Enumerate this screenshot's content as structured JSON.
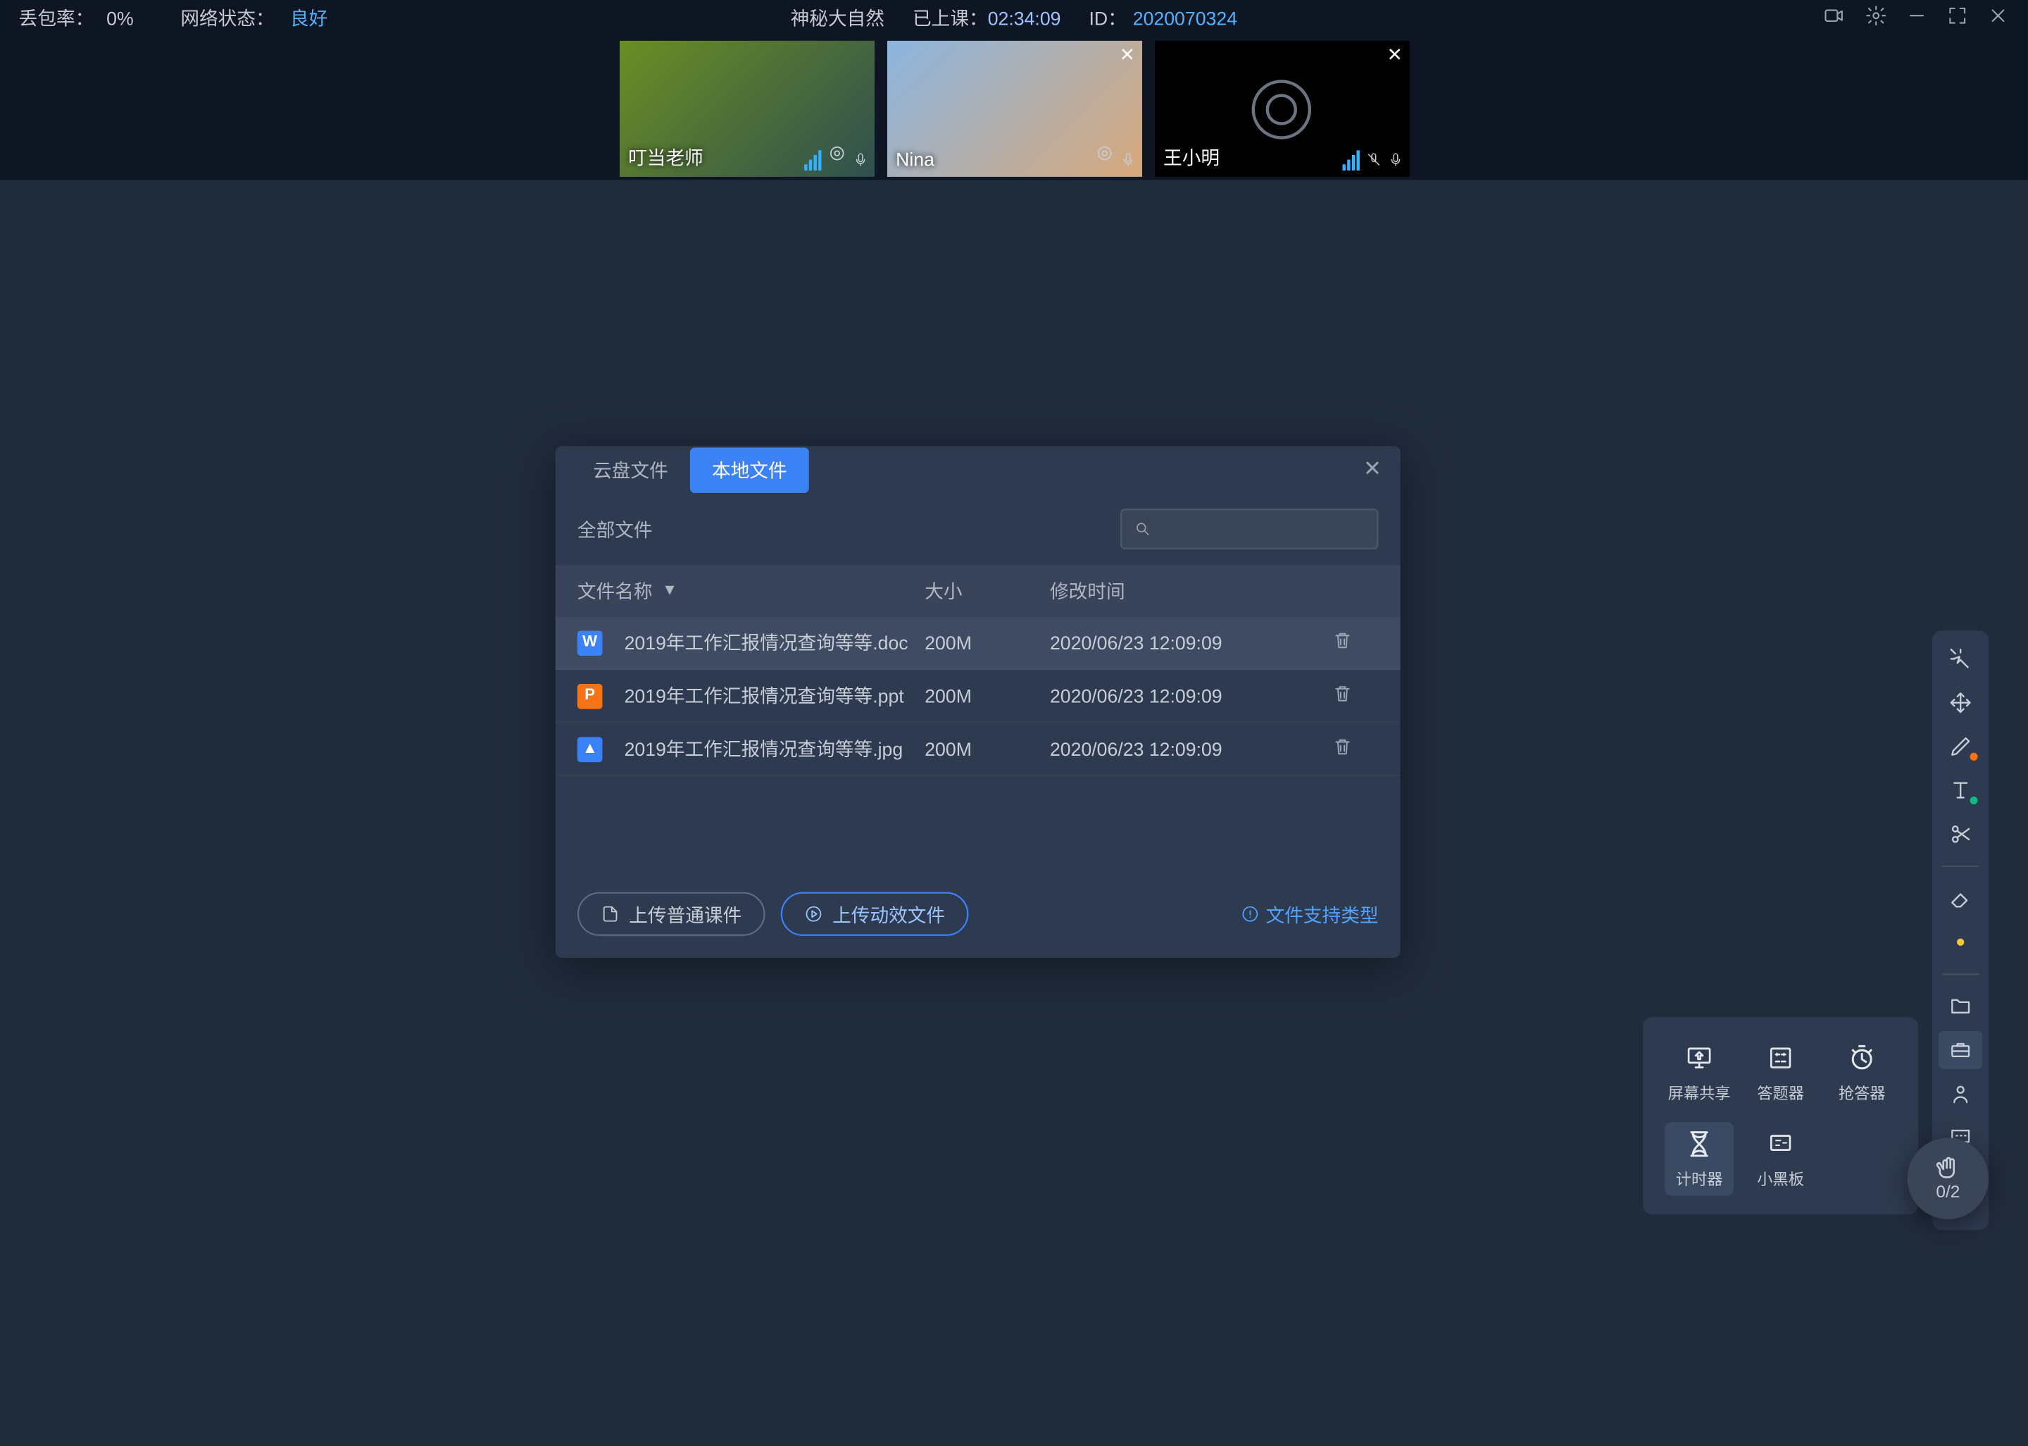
{
  "topbar": {
    "loss_label": "丢包率：",
    "loss_value": "0%",
    "net_label": "网络状态：",
    "net_value": "良好",
    "room_title": "神秘大自然",
    "elapsed_label": "已上课：",
    "elapsed_value": "02:34:09",
    "id_label": "ID：",
    "id_value": "2020070324"
  },
  "participants": [
    {
      "name": "叮当老师",
      "closable": false,
      "muted": false,
      "camera_off": false
    },
    {
      "name": "Nina",
      "closable": true,
      "muted": false,
      "camera_off": false
    },
    {
      "name": "王小明",
      "closable": true,
      "muted": true,
      "camera_off": true
    }
  ],
  "dialog": {
    "tab_cloud": "云盘文件",
    "tab_local": "本地文件",
    "active_tab": "local",
    "breadcrumb": "全部文件",
    "search_placeholder": "",
    "col_name": "文件名称",
    "col_size": "大小",
    "col_time": "修改时间",
    "files": [
      {
        "icon": "W",
        "icon_class": "w",
        "name": "2019年工作汇报情况查询等等.doc",
        "size": "200M",
        "time": "2020/06/23 12:09:09",
        "selected": true
      },
      {
        "icon": "P",
        "icon_class": "p",
        "name": "2019年工作汇报情况查询等等.ppt",
        "size": "200M",
        "time": "2020/06/23 12:09:09",
        "selected": false
      },
      {
        "icon": "▲",
        "icon_class": "i",
        "name": "2019年工作汇报情况查询等等.jpg",
        "size": "200M",
        "time": "2020/06/23 12:09:09",
        "selected": false
      }
    ],
    "btn_upload_normal": "上传普通课件",
    "btn_upload_anim": "上传动效文件",
    "support_link": "文件支持类型"
  },
  "tool_popover": {
    "items": [
      {
        "key": "screen_share",
        "label": "屏幕共享"
      },
      {
        "key": "answer_tool",
        "label": "答题器"
      },
      {
        "key": "quick_answer",
        "label": "抢答器"
      },
      {
        "key": "timer",
        "label": "计时器"
      },
      {
        "key": "blackboard",
        "label": "小黑板"
      }
    ],
    "selected": "timer"
  },
  "hand_raise": {
    "count": "0/2"
  },
  "colors": {
    "accent": "#3b82f6",
    "panel": "#2e3a4f",
    "bg": "#202b3c"
  }
}
